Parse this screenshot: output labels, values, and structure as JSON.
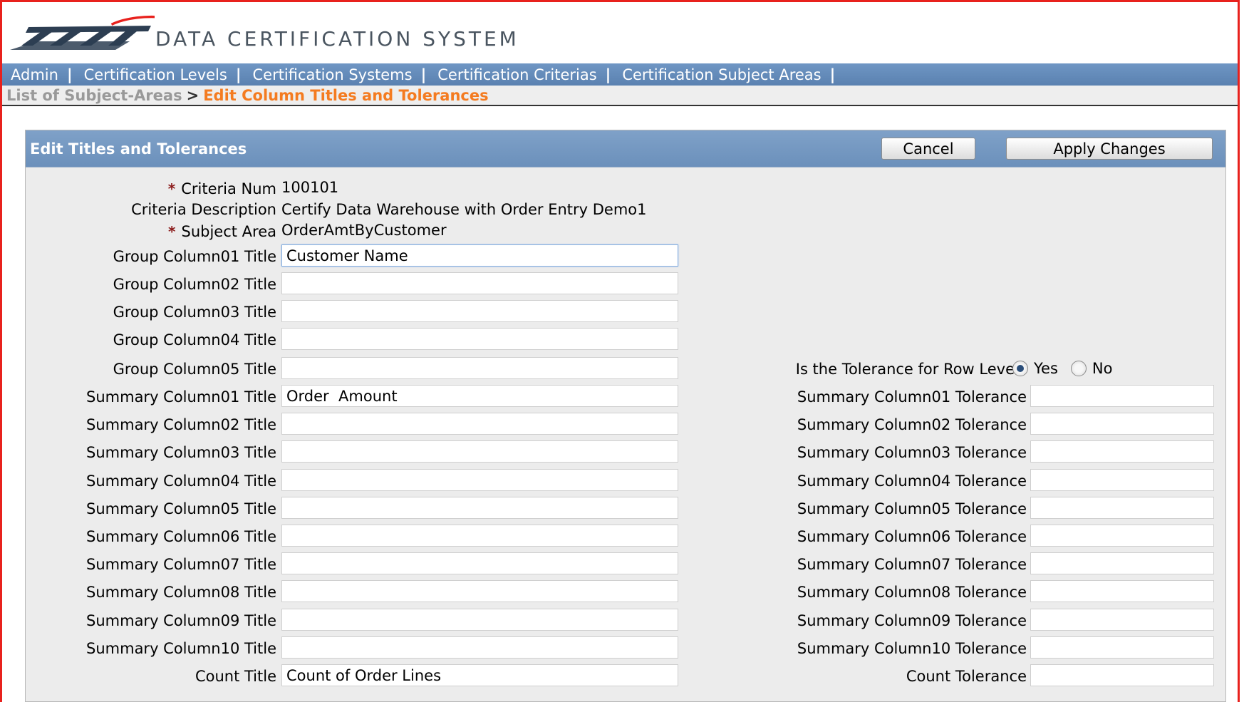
{
  "header": {
    "brand_text": "DATA CERTIFICATION SYSTEM"
  },
  "nav": {
    "items": [
      {
        "label": "Admin"
      },
      {
        "label": "Certification Levels"
      },
      {
        "label": "Certification Systems"
      },
      {
        "label": "Certification Criterias"
      },
      {
        "label": "Certification Subject Areas"
      }
    ],
    "separator": "|"
  },
  "breadcrumb": {
    "parent": "List of Subject-Areas",
    "separator": ">",
    "current": "Edit Column Titles and Tolerances"
  },
  "region": {
    "title": "Edit Titles and Tolerances",
    "cancel_label": "Cancel",
    "apply_label": "Apply Changes"
  },
  "form": {
    "required_marker": "*",
    "criteria_num": {
      "label": "Criteria Num",
      "value": "100101"
    },
    "criteria_description": {
      "label": "Criteria Description",
      "value": "Certify Data Warehouse with Order Entry Demo1"
    },
    "subject_area": {
      "label": "Subject Area",
      "value": "OrderAmtByCustomer"
    },
    "group_columns": [
      {
        "label": "Group Column01 Title",
        "value": "Customer Name"
      },
      {
        "label": "Group Column02 Title",
        "value": ""
      },
      {
        "label": "Group Column03 Title",
        "value": ""
      },
      {
        "label": "Group Column04 Title",
        "value": ""
      },
      {
        "label": "Group Column05 Title",
        "value": ""
      }
    ],
    "row_level": {
      "label": "Is the Tolerance for Row Level?",
      "yes_label": "Yes",
      "no_label": "No",
      "selected": "Yes"
    },
    "summary_columns": [
      {
        "label": "Summary Column01 Title",
        "value": "Order  Amount",
        "tol_label": "Summary Column01 Tolerance",
        "tol_value": ""
      },
      {
        "label": "Summary Column02 Title",
        "value": "",
        "tol_label": "Summary Column02 Tolerance",
        "tol_value": ""
      },
      {
        "label": "Summary Column03 Title",
        "value": "",
        "tol_label": "Summary Column03 Tolerance",
        "tol_value": ""
      },
      {
        "label": "Summary Column04 Title",
        "value": "",
        "tol_label": "Summary Column04 Tolerance",
        "tol_value": ""
      },
      {
        "label": "Summary Column05 Title",
        "value": "",
        "tol_label": "Summary Column05 Tolerance",
        "tol_value": ""
      },
      {
        "label": "Summary Column06 Title",
        "value": "",
        "tol_label": "Summary Column06 Tolerance",
        "tol_value": ""
      },
      {
        "label": "Summary Column07 Title",
        "value": "",
        "tol_label": "Summary Column07 Tolerance",
        "tol_value": ""
      },
      {
        "label": "Summary Column08 Title",
        "value": "",
        "tol_label": "Summary Column08 Tolerance",
        "tol_value": ""
      },
      {
        "label": "Summary Column09 Title",
        "value": "",
        "tol_label": "Summary Column09 Tolerance",
        "tol_value": ""
      },
      {
        "label": "Summary Column10 Title",
        "value": "",
        "tol_label": "Summary Column10 Tolerance",
        "tol_value": ""
      }
    ],
    "count": {
      "label": "Count Title",
      "value": "Count of Order Lines",
      "tol_label": "Count Tolerance",
      "tol_value": ""
    }
  },
  "colors": {
    "frame_border": "#e8211d",
    "nav_bg": "#5a81b0",
    "breadcrumb_current": "#f47b20",
    "breadcrumb_parent": "#999999",
    "required_marker": "#8b1a1a",
    "region_header": "#6b90bb"
  }
}
